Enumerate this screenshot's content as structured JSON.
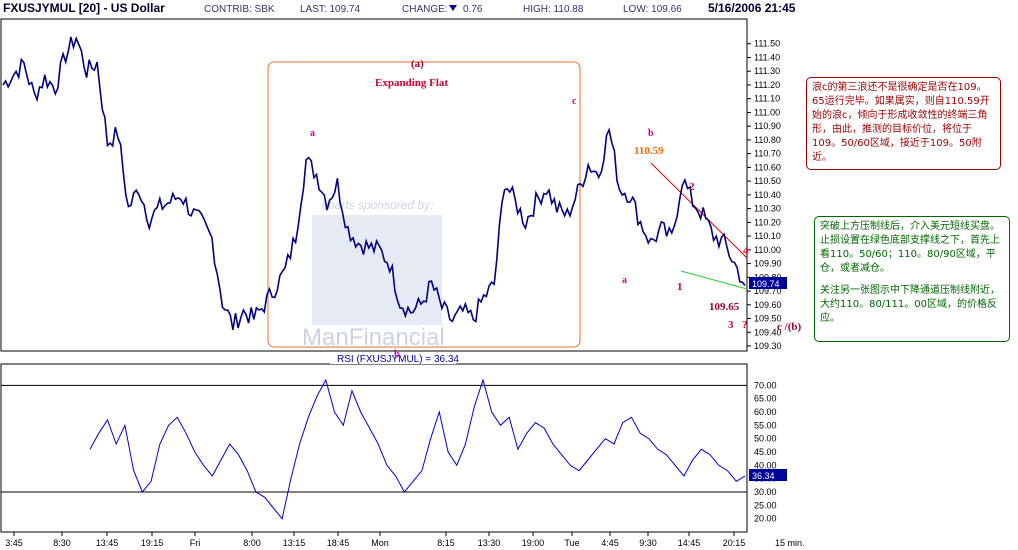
{
  "header": {
    "symbol": "FXUSJYMUL [20] - US Dollar",
    "contrib": "CONTRIB: SBK",
    "last": "LAST: 109.74",
    "change": "CHANGE:",
    "change_value": "0.76",
    "high": "HIGH: 110.88",
    "low": "LOW: 109.66",
    "datetime": "5/16/2006 21:45"
  },
  "rsi_label": "RSI (FXUSJYMUL) = 36.34",
  "price_tag": "109.74",
  "rsi_tag": "36.34",
  "watermark": {
    "sponsor": "charts sponsored by:",
    "brand": "ManFinancial"
  },
  "annotations": {
    "box_label": "(a)",
    "pattern": "Expanding  Flat",
    "a_top": "a",
    "b_bottom": "b",
    "c_top": "c",
    "b_right": "b",
    "b_price": "110.59",
    "a_right": "a",
    "w1": "1",
    "w2": "2",
    "w3": "3",
    "q": "?",
    "w4": "4",
    "c_b": "c /(b)",
    "low_price": "109.65"
  },
  "notes": {
    "red": "浪c的第三浪还不是很确定是否在109。65运行完毕。如果属实，则自110.59开始的浪c，倾向于形成收敛性的终端三角形，由此，推测的目标价位，将位于109。50/60区域，接近于109。50附近。",
    "green_1": "突破上方压制线后，介入美元短线买盘。止损设置在绿色底部支撑线之下，首先上看110。50/60；110。80/90区域，平仓，或者减仓。",
    "green_2": "关注另一张图示中下降通道压制线附近，大约110。80/111。00区域，的价格反应。"
  },
  "colors": {
    "price": "#000080",
    "rsi": "#0000cc",
    "box": "#e07030",
    "upper_line": "#dd0000",
    "lower_line": "#33cc33",
    "tag": "#000099"
  },
  "chart_data": [
    {
      "type": "line",
      "title": "FXUSJYMUL [20] - US Dollar",
      "ylim": [
        109.3,
        111.6
      ],
      "y_ticks": [
        "111.50",
        "111.40",
        "111.30",
        "111.20",
        "111.10",
        "111.00",
        "110.90",
        "110.80",
        "110.70",
        "110.60",
        "110.50",
        "110.40",
        "110.30",
        "110.20",
        "110.10",
        "110.00",
        "109.90",
        "109.80",
        "109.70",
        "109.60",
        "109.50",
        "109.40",
        "109.30"
      ],
      "x_ticks": [
        "3:45",
        "8:30",
        "13:45",
        "19:15",
        "Fri",
        "8:00",
        "13:15",
        "18:45",
        "Mon",
        "8:15",
        "13:30",
        "19:00",
        "Tue",
        "4:45",
        "9:30",
        "14:45",
        "20:15",
        "15 min."
      ],
      "x": [
        0,
        6,
        11,
        17,
        22,
        28,
        33,
        39,
        44,
        50,
        56,
        61,
        67,
        72,
        78,
        83,
        89,
        95,
        100,
        106,
        111,
        117,
        122,
        128,
        134,
        139,
        145,
        150,
        156,
        161,
        167,
        172,
        178,
        184,
        189,
        195
      ],
      "series": [
        {
          "values": [
            111.2,
            111.28,
            111.35,
            111.12,
            111.25,
            111.18,
            111.42,
            111.55,
            111.3,
            111.36,
            110.78,
            110.85,
            110.3,
            110.45,
            110.22,
            110.31,
            110.35,
            110.4,
            110.28,
            110.2,
            110.08,
            109.62,
            109.45,
            109.55,
            109.5,
            109.6,
            109.72,
            109.85,
            110.1,
            110.65,
            110.55,
            110.35,
            110.48,
            110.15,
            110.05,
            110.02
          ]
        },
        {
          "values": [
            110.0,
            109.9,
            109.62,
            109.55,
            109.6,
            109.75,
            109.58,
            109.48,
            109.55,
            109.5,
            109.65,
            109.75,
            110.5,
            110.35,
            110.2,
            110.35,
            110.45,
            110.3,
            110.25,
            110.42,
            110.62,
            110.55,
            110.88,
            110.45,
            110.4,
            110.2,
            110.05,
            110.15,
            110.08,
            110.52,
            110.35,
            110.25,
            110.1,
            110.05,
            109.9,
            109.74
          ]
        }
      ]
    },
    {
      "type": "line",
      "title": "RSI (FXUSJYMUL) = 36.34",
      "ylim": [
        15,
        75
      ],
      "y_ticks": [
        "70.00",
        "65.00",
        "60.00",
        "55.00",
        "50.00",
        "45.00",
        "40.00",
        "35.00",
        "30.00",
        "25.00",
        "20.00"
      ],
      "reference_lines": [
        70,
        30
      ],
      "series": [
        {
          "values": [
            46,
            52,
            57,
            48,
            55,
            38,
            30,
            34,
            48,
            55,
            58,
            52,
            45,
            40,
            36,
            42,
            48,
            44,
            38,
            30,
            28,
            24,
            20,
            35,
            48,
            58,
            66,
            72,
            60,
            55,
            68,
            60,
            54,
            48,
            40,
            36,
            30,
            34,
            38,
            50,
            60,
            45,
            40,
            48,
            62,
            72,
            60,
            55,
            58,
            46,
            52,
            56,
            54,
            48,
            44,
            40,
            38,
            42,
            46,
            50,
            48,
            56,
            58,
            52,
            50,
            46,
            44,
            40,
            36,
            42,
            46,
            44,
            40,
            38,
            34,
            36
          ]
        }
      ]
    }
  ]
}
